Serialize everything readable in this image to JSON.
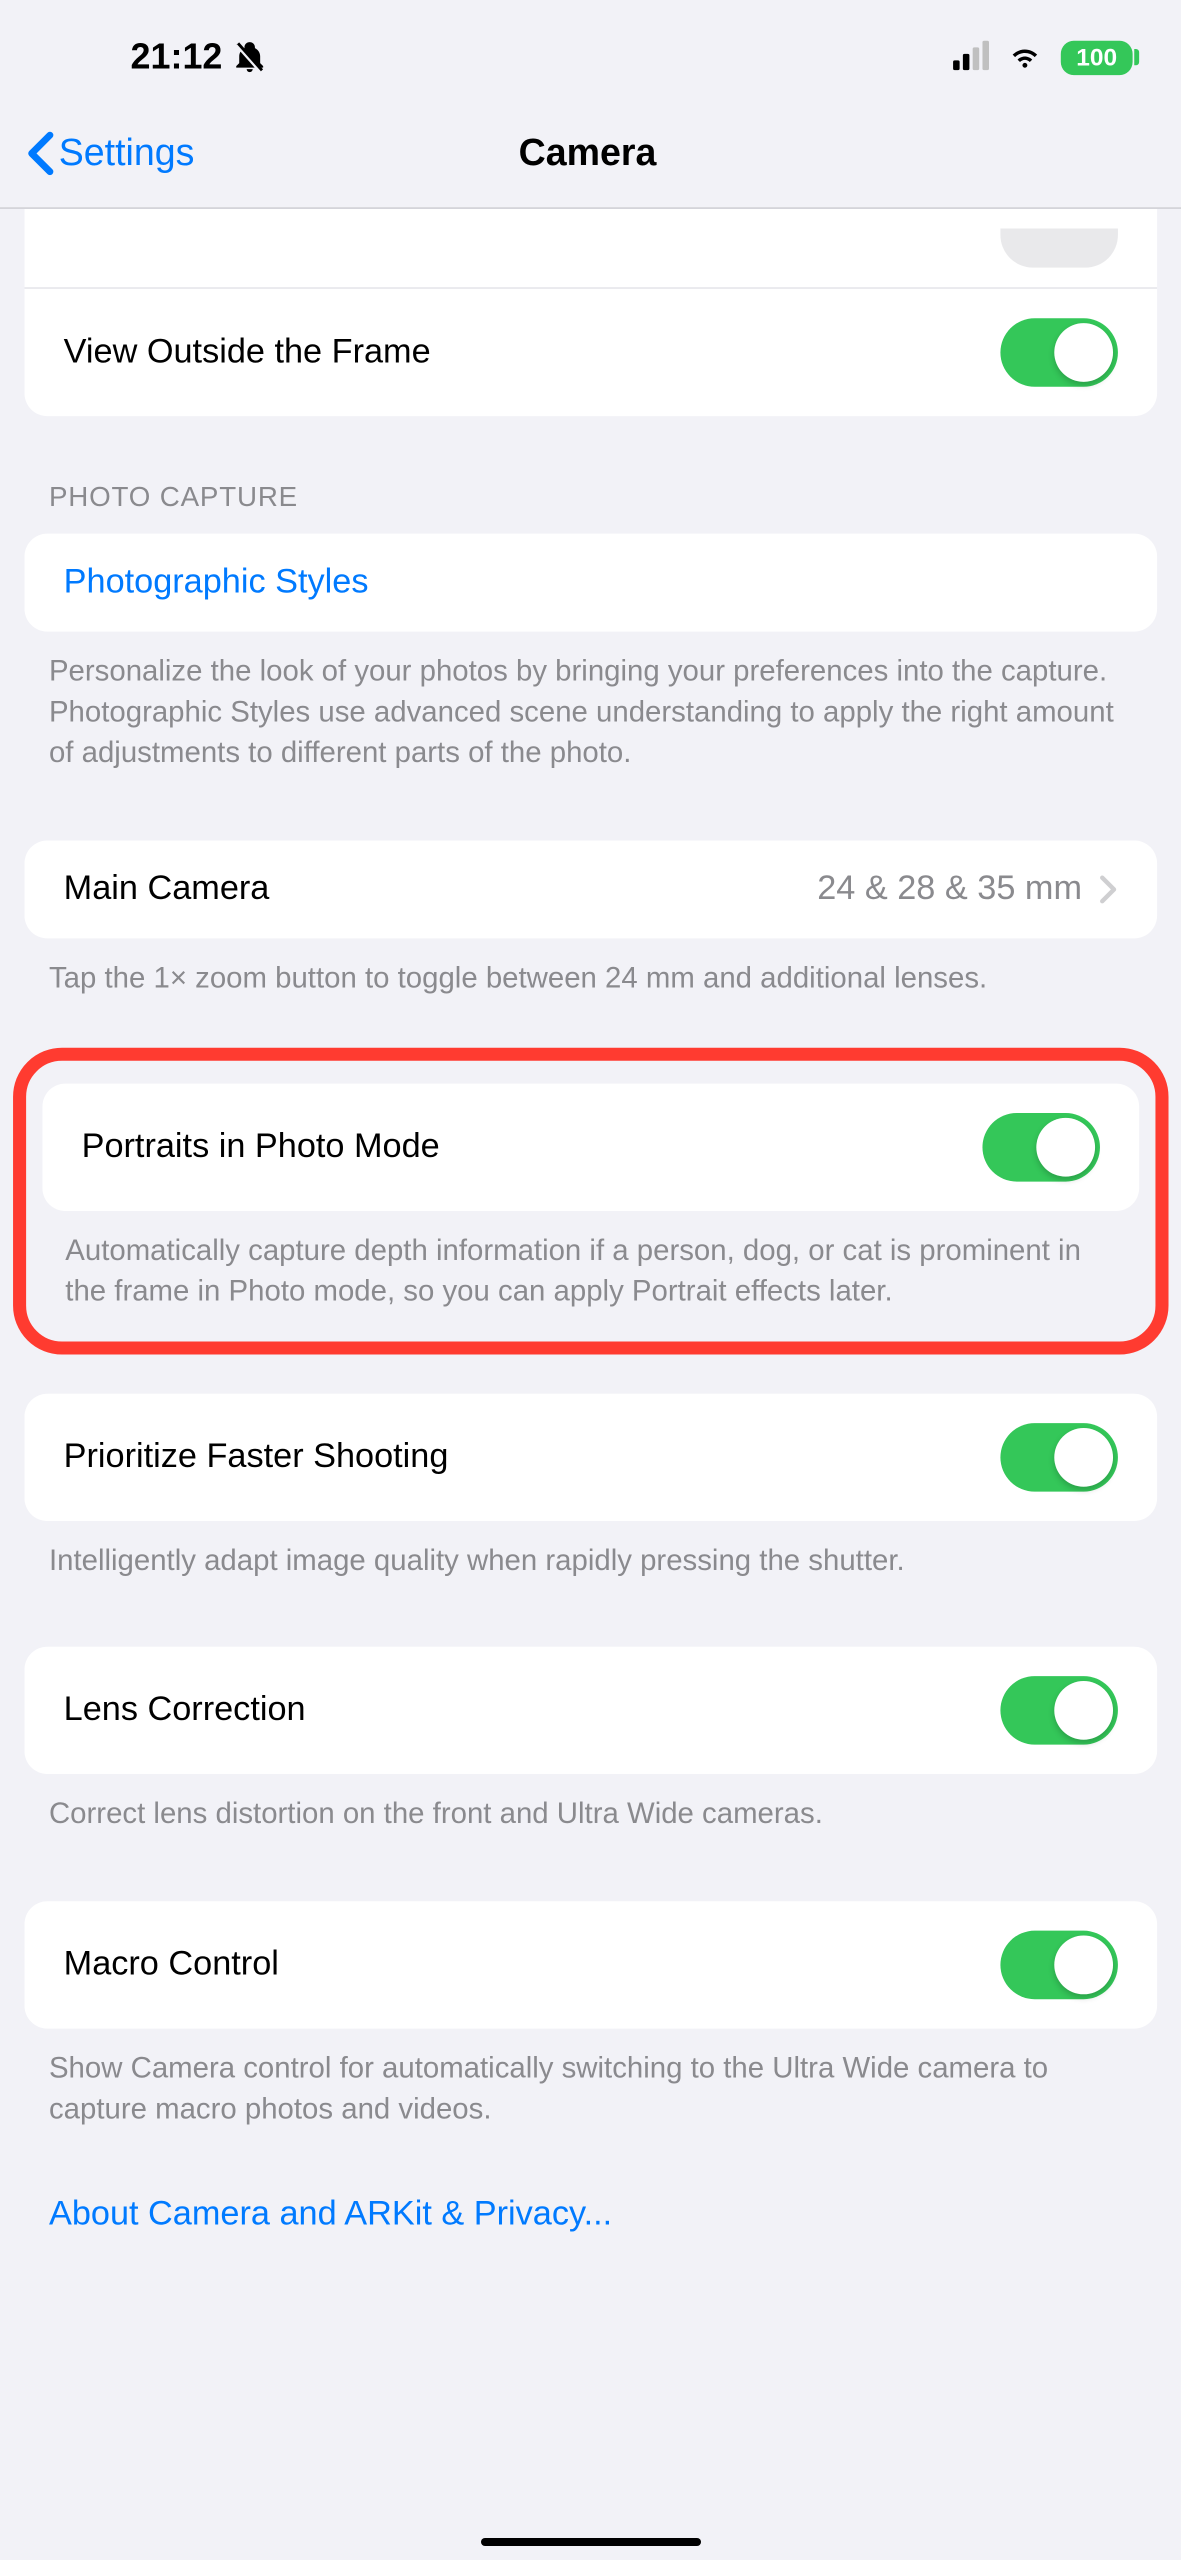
{
  "statusBar": {
    "time": "21:12",
    "battery": "100"
  },
  "nav": {
    "back": "Settings",
    "title": "Camera"
  },
  "partialRow": {
    "label": ""
  },
  "viewOutside": {
    "label": "View Outside the Frame"
  },
  "photoCapture": {
    "header": "PHOTO CAPTURE",
    "styles": {
      "label": "Photographic Styles",
      "footer": "Personalize the look of your photos by bringing your preferences into the capture. Photographic Styles use advanced scene understanding to apply the right amount of adjustments to different parts of the photo."
    }
  },
  "mainCamera": {
    "label": "Main Camera",
    "value": "24 & 28 & 35 mm",
    "footer": "Tap the 1× zoom button to toggle between 24 mm and additional lenses."
  },
  "portraits": {
    "label": "Portraits in Photo Mode",
    "footer": "Automatically capture depth information if a person, dog, or cat is prominent in the frame in Photo mode, so you can apply Portrait effects later."
  },
  "prioritize": {
    "label": "Prioritize Faster Shooting",
    "footer": "Intelligently adapt image quality when rapidly pressing the shutter."
  },
  "lens": {
    "label": "Lens Correction",
    "footer": "Correct lens distortion on the front and Ultra Wide cameras."
  },
  "macro": {
    "label": "Macro Control",
    "footer": "Show Camera control for automatically switching to the Ultra Wide camera to capture macro photos and videos."
  },
  "privacy": {
    "label": "About Camera and ARKit & Privacy..."
  }
}
